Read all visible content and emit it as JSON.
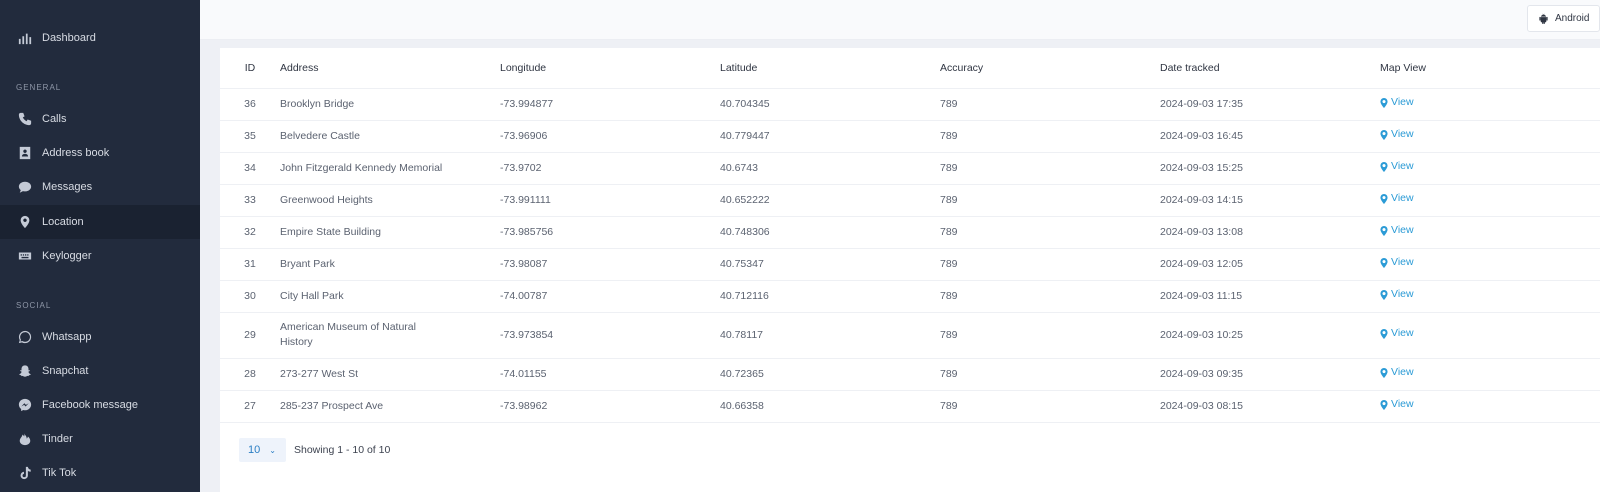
{
  "sidebar": {
    "dashboard": "Dashboard",
    "general_label": "GENERAL",
    "calls": "Calls",
    "address_book": "Address book",
    "messages": "Messages",
    "location": "Location",
    "keylogger": "Keylogger",
    "social_label": "SOCIAL",
    "whatsapp": "Whatsapp",
    "snapchat": "Snapchat",
    "facebook": "Facebook message",
    "tinder": "Tinder",
    "tiktok": "Tik Tok"
  },
  "topbar": {
    "device": "Android"
  },
  "table": {
    "headers": [
      "ID",
      "Address",
      "Longitude",
      "Latitude",
      "Accuracy",
      "Date tracked",
      "Map View"
    ],
    "rows": [
      [
        "36",
        "Brooklyn Bridge",
        "-73.994877",
        "40.704345",
        "789",
        "2024-09-03 17:35",
        "View"
      ],
      [
        "35",
        "Belvedere Castle",
        "-73.96906",
        "40.779447",
        "789",
        "2024-09-03 16:45",
        "View"
      ],
      [
        "34",
        "John Fitzgerald Kennedy Memorial",
        "-73.9702",
        "40.6743",
        "789",
        "2024-09-03 15:25",
        "View"
      ],
      [
        "33",
        "Greenwood Heights",
        "-73.991111",
        "40.652222",
        "789",
        "2024-09-03 14:15",
        "View"
      ],
      [
        "32",
        "Empire State Building",
        "-73.985756",
        "40.748306",
        "789",
        "2024-09-03 13:08",
        "View"
      ],
      [
        "31",
        "Bryant Park",
        "-73.98087",
        "40.75347",
        "789",
        "2024-09-03 12:05",
        "View"
      ],
      [
        "30",
        "City Hall Park",
        "-74.00787",
        "40.712116",
        "789",
        "2024-09-03 11:15",
        "View"
      ],
      [
        "29",
        "American Museum of Natural History",
        "-73.973854",
        "40.78117",
        "789",
        "2024-09-03 10:25",
        "View"
      ],
      [
        "28",
        "273-277 West St",
        "-74.01155",
        "40.72365",
        "789",
        "2024-09-03 09:35",
        "View"
      ],
      [
        "27",
        "285-237 Prospect Ave",
        "-73.98962",
        "40.66358",
        "789",
        "2024-09-03 08:15",
        "View"
      ]
    ]
  },
  "pager": {
    "page_size": "10",
    "showing": "Showing 1 - 10 of 10"
  }
}
